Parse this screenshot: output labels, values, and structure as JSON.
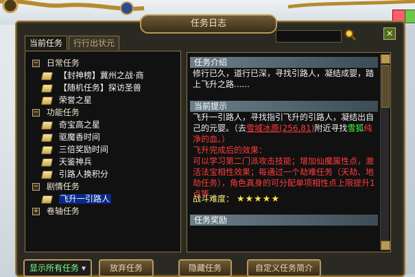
{
  "window": {
    "title": "任务日志",
    "search_placeholder": ""
  },
  "tabs": [
    {
      "label": "当前任务",
      "active": true
    },
    {
      "label": "行行出状元",
      "active": false
    }
  ],
  "tree": [
    {
      "type": "category",
      "label": "日常任务",
      "expanded": true
    },
    {
      "type": "quest",
      "label": "【封神榜】冀州之战·商"
    },
    {
      "type": "quest",
      "label": "【随机任务】探访圣兽"
    },
    {
      "type": "quest",
      "label": "荣誉之星"
    },
    {
      "type": "category",
      "label": "功能任务",
      "expanded": true
    },
    {
      "type": "quest",
      "label": "奇宝高之星"
    },
    {
      "type": "quest",
      "label": "驱魔香时间"
    },
    {
      "type": "quest",
      "label": "三倍奖励时间"
    },
    {
      "type": "quest",
      "label": "天鉴神兵"
    },
    {
      "type": "quest",
      "label": "引路人换积分"
    },
    {
      "type": "category",
      "label": "剧情任务",
      "expanded": true
    },
    {
      "type": "quest",
      "label": "飞升一引路人",
      "selected": true
    },
    {
      "type": "category",
      "label": "卷轴任务",
      "expanded": false
    }
  ],
  "detail": {
    "intro_title": "任务介绍",
    "intro_text": "修行已久，道行已深，寻找引路人，凝结成婴，踏上飞升之路......",
    "hint_title": "当前提示",
    "hint_text_1": "飞升一引路人，寻找指引飞升的引路人，凝结出自己的元婴。（去",
    "hint_link": "雪域冰原(256,81)",
    "hint_text_2": "附近寻找",
    "hint_target": "雪狐",
    "hint_text_3": "纯净的血。）",
    "reward_title": "飞升完成后的效果：",
    "reward_text": "可以学习第二门派攻击技能；增加仙魔属性点，激活法宝相性效果；每通过一个劫难任务（天劫、地劫任务），角色真身的可分配单项相性点上限提升1点等",
    "difficulty_label": "战斗难度：",
    "difficulty_stars": "★★★★★",
    "reward_section_title": "任务奖励"
  },
  "buttons": {
    "show_all": "显示所有任务",
    "abandon": "放弃任务",
    "hide": "隐藏任务",
    "custom": "自定义任务简介"
  },
  "colors": {
    "panel_bg": "#111111",
    "frame_gold": "#9a7a3a",
    "section_header": "#6c7f8a",
    "selected_bg": "#0a2a8a",
    "hint_red": "#ff3b3b",
    "hint_green": "#42ff42"
  },
  "icons": {
    "search": "magnifier-icon",
    "close": "close-icon",
    "quest": "book-icon",
    "expand": "expand-icon"
  }
}
